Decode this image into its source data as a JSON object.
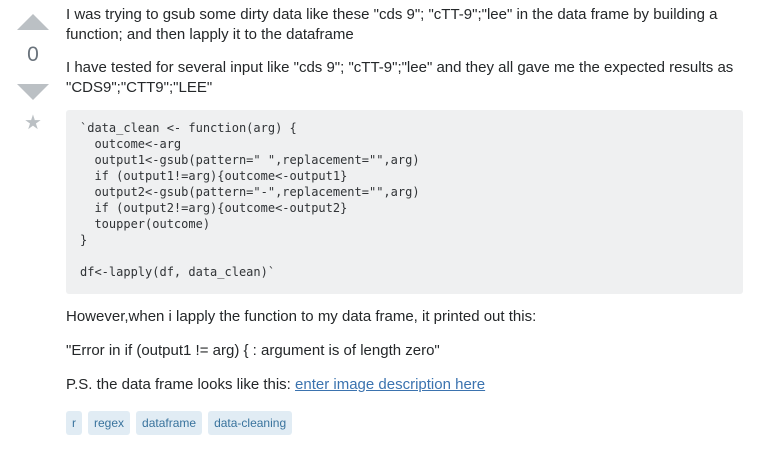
{
  "votes": {
    "count": "0",
    "up_icon": "upvote-arrow-icon",
    "down_icon": "downvote-arrow-icon",
    "favorite_icon": "star-icon",
    "favorite_glyph": "★"
  },
  "post": {
    "paragraph1": "I was trying to gsub some dirty data like these \"cds 9\"; \"cTT-9\";\"lee\" in the data frame by building a function; and then lapply it to the dataframe",
    "paragraph2": "I have tested for several input like \"cds 9\"; \"cTT-9\";\"lee\" and they all gave me the expected results as \"CDS9\";\"CTT9\";\"LEE\"",
    "code_lines": [
      "`data_clean <- function(arg) {",
      "  outcome<-arg",
      "  output1<-gsub(pattern=\" \",replacement=\"\",arg)",
      "  if (output1!=arg){outcome<-output1}",
      "  output2<-gsub(pattern=\"-\",replacement=\"\",arg)",
      "  if (output2!=arg){outcome<-output2}",
      "  toupper(outcome)",
      "}",
      "",
      "df<-lapply(df, data_clean)`"
    ],
    "paragraph3": "However,when i lapply the function to my data frame, it printed out this:",
    "paragraph4": "\"Error in if (output1 != arg) { : argument is of length zero\"",
    "paragraph5_prefix": "P.S. the data frame looks like this: ",
    "image_link_text": "enter image description here"
  },
  "tags": [
    "r",
    "regex",
    "dataframe",
    "data-cleaning"
  ],
  "colors": {
    "tag_bg": "#e1ecf4",
    "tag_text": "#39739d",
    "link": "#3b73af",
    "code_bg": "#eff0f1",
    "vote_arrow": "#bbc0c4"
  }
}
